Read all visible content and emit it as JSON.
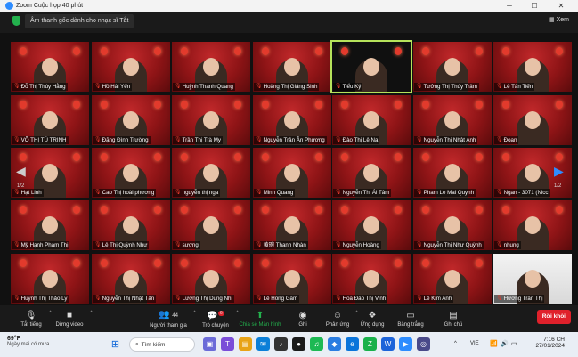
{
  "window": {
    "title": "Zoom Cuộc họp 40 phút"
  },
  "notice": {
    "text": "Âm thanh gốc dành cho nhạc sĩ Tắt"
  },
  "view_button": {
    "label": "Xem"
  },
  "participants": [
    "Đỗ Thị Thúy Hằng",
    "Hồ Hải Yến",
    "Huỳnh Thanh Quang",
    "Hoàng Thị Giáng Sinh",
    "Tiểu Ký",
    "Tưởng Thị Thúy Trâm",
    "Lê Tấn Tiến",
    "VÕ THỊ TÚ TRINH",
    "Đặng Đình Trường",
    "Trần Thị Trà My",
    "Nguyễn Trần Ân Phương",
    "Đào Thị Lê Na",
    "Nguyễn Thị Nhật Anh",
    "Đoan",
    "Hạt Linh",
    "Cao Thị hoài phương",
    "nguyễn thị nga",
    "Minh Quang",
    "Nguyễn Thị Ái Tâm",
    "Pham Le Mai Quynh",
    "Ngan - 3071 (Nicc",
    "Mỹ Hạnh Phạm Thị",
    "Lê Thị Quỳnh Như",
    "sương",
    "黄琬 Thanh Nhàn",
    "Nguyễn Hoàng",
    "Nguyễn Thị Như Quỳnh",
    "nhung",
    "Huỳnh Thị Thảo Ly",
    "Nguyễn Thị Nhật Tân",
    "Lương Thị Dung Nhi",
    "Lê Hồng Gấm",
    "Hoa Đào Thị Vinh",
    "Lê Kim Anh",
    "Hương Trần Thị"
  ],
  "pagination": {
    "left": "1/2",
    "right": "1/2"
  },
  "controls": [
    {
      "label": "Tắt tiếng",
      "icon": "mic-icon"
    },
    {
      "label": "Dừng video",
      "icon": "video-icon"
    },
    {
      "label": "Người tham gia",
      "icon": "participants-icon",
      "count": "44"
    },
    {
      "label": "Trò chuyện",
      "icon": "chat-icon",
      "badge": "6"
    },
    {
      "label": "Chia sẻ Màn hình",
      "icon": "share-screen-icon"
    },
    {
      "label": "Ghi",
      "icon": "record-icon"
    },
    {
      "label": "Phản ứng",
      "icon": "reactions-icon"
    },
    {
      "label": "Ứng dụng",
      "icon": "apps-icon"
    },
    {
      "label": "Bảng trắng",
      "icon": "whiteboard-icon"
    },
    {
      "label": "Ghi chú",
      "icon": "notes-icon"
    }
  ],
  "leave_button": {
    "label": "Rời khỏi"
  },
  "taskbar": {
    "weather_temp": "69°F",
    "weather_desc": "Ngày mai có mưa",
    "search_placeholder": "Tìm kiếm",
    "language": "VIE",
    "time": "7:16 CH",
    "date": "27/01/2024"
  },
  "colors": {
    "accent": "#2d8cff",
    "leave": "#e0212b",
    "share": "#23b14d",
    "active_speaker": "#b6e35b"
  }
}
